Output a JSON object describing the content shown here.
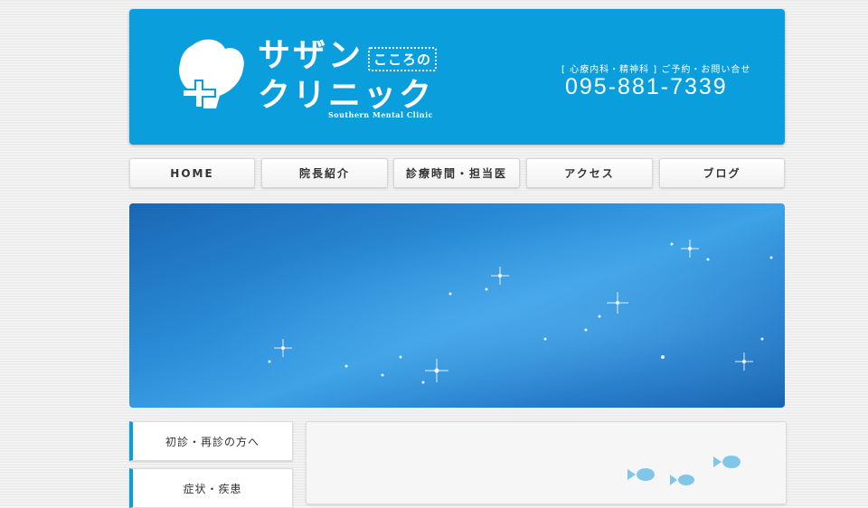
{
  "header": {
    "logo_name_line1": "サザン",
    "logo_name_line2": "クリニック",
    "logo_badge": "こころの",
    "logo_en": "Southern Mental Clinic",
    "tagline": "[ 心療内科・精神科 ] ご予約・お問い合せ",
    "phone": "095-881-7339",
    "brand_color": "#0a9fdc"
  },
  "nav": {
    "items": [
      {
        "label": "HOME"
      },
      {
        "label": "院長紹介"
      },
      {
        "label": "診療時間・担当医"
      },
      {
        "label": "アクセス"
      },
      {
        "label": "ブログ"
      }
    ]
  },
  "hero": {
    "image": "sparkling-water"
  },
  "side_menu": {
    "items": [
      {
        "label": "初診・再診の方へ"
      },
      {
        "label": "症状・疾患"
      }
    ]
  },
  "content": {
    "decoration": "fish-icons"
  }
}
